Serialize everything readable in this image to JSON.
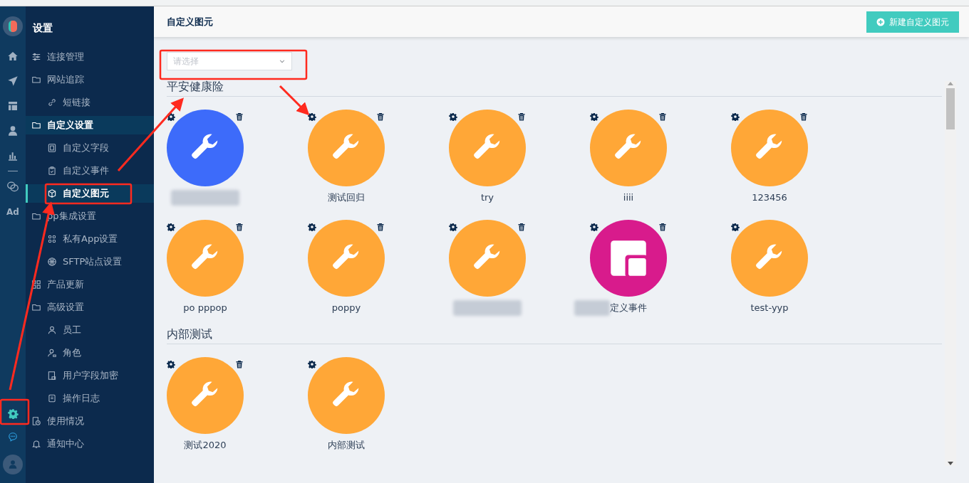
{
  "rail": {
    "items": [
      {
        "selected": false
      },
      {
        "selected": false
      },
      {
        "selected": false
      },
      {
        "selected": false
      },
      {
        "selected": false
      },
      {
        "selected": false
      },
      {
        "label": "Ad",
        "selected": false
      }
    ],
    "bottom": [
      {
        "selected": true
      },
      {
        "selected": false
      }
    ]
  },
  "sidebar": {
    "title": "设置",
    "items": [
      {
        "label": "连接管理",
        "selected": false
      },
      {
        "label": "网站追踪",
        "selected": false,
        "children": [
          {
            "label": "短链接",
            "selected": false
          }
        ]
      },
      {
        "label": "自定义设置",
        "selected": true,
        "children": [
          {
            "label": "自定义字段",
            "selected": false
          },
          {
            "label": "自定义事件",
            "selected": false
          },
          {
            "label": "自定义图元",
            "selected": true
          }
        ]
      },
      {
        "label": "pp集成设置",
        "selected": false,
        "children": [
          {
            "label": "私有App设置",
            "selected": false
          },
          {
            "label": "SFTP站点设置",
            "selected": false
          }
        ]
      },
      {
        "label": "产品更新",
        "selected": false
      },
      {
        "label": "高级设置",
        "selected": false,
        "children": [
          {
            "label": "员工",
            "selected": false
          },
          {
            "label": "角色",
            "selected": false
          },
          {
            "label": "用户字段加密",
            "selected": false
          },
          {
            "label": "操作日志",
            "selected": false
          }
        ]
      },
      {
        "label": "使用情况",
        "selected": false
      },
      {
        "label": "通知中心",
        "selected": false
      }
    ]
  },
  "header": {
    "title": "自定义图元",
    "button": "新建自定义图元"
  },
  "filter": {
    "placeholder": "请选择"
  },
  "groups": [
    {
      "title": "平安健康险",
      "items": [
        {
          "kind": "wrench",
          "color": "#3d6bfa",
          "redacted": true,
          "deletable": true
        },
        {
          "kind": "wrench",
          "color": "#ffa737",
          "label": "测试回归",
          "deletable": true
        },
        {
          "kind": "wrench",
          "color": "#ffa737",
          "label": "try",
          "deletable": true
        },
        {
          "kind": "wrench",
          "color": "#ffa737",
          "label": "iiii",
          "deletable": true
        },
        {
          "kind": "wrench",
          "color": "#ffa737",
          "label": "123456",
          "deletable": true
        },
        {
          "kind": "wrench",
          "color": "#ffa737",
          "label": "po pppop",
          "deletable": true
        },
        {
          "kind": "wrench",
          "color": "#ffa737",
          "label": "poppy",
          "deletable": true
        },
        {
          "kind": "wrench",
          "color": "#ffa737",
          "redacted": true,
          "deletable": true
        },
        {
          "kind": "layout",
          "color": "#d81b8c",
          "redacted": true,
          "label": "定义事件",
          "deletable": true
        },
        {
          "kind": "wrench",
          "color": "#ffa737",
          "label": "test-yyp",
          "deletable": false
        }
      ]
    },
    {
      "title": "内部测试",
      "items": [
        {
          "kind": "wrench",
          "color": "#ffa737",
          "label": "测试2020",
          "deletable": true
        },
        {
          "kind": "wrench",
          "color": "#ffa737",
          "label": "内部测试",
          "deletable": false
        }
      ]
    }
  ]
}
